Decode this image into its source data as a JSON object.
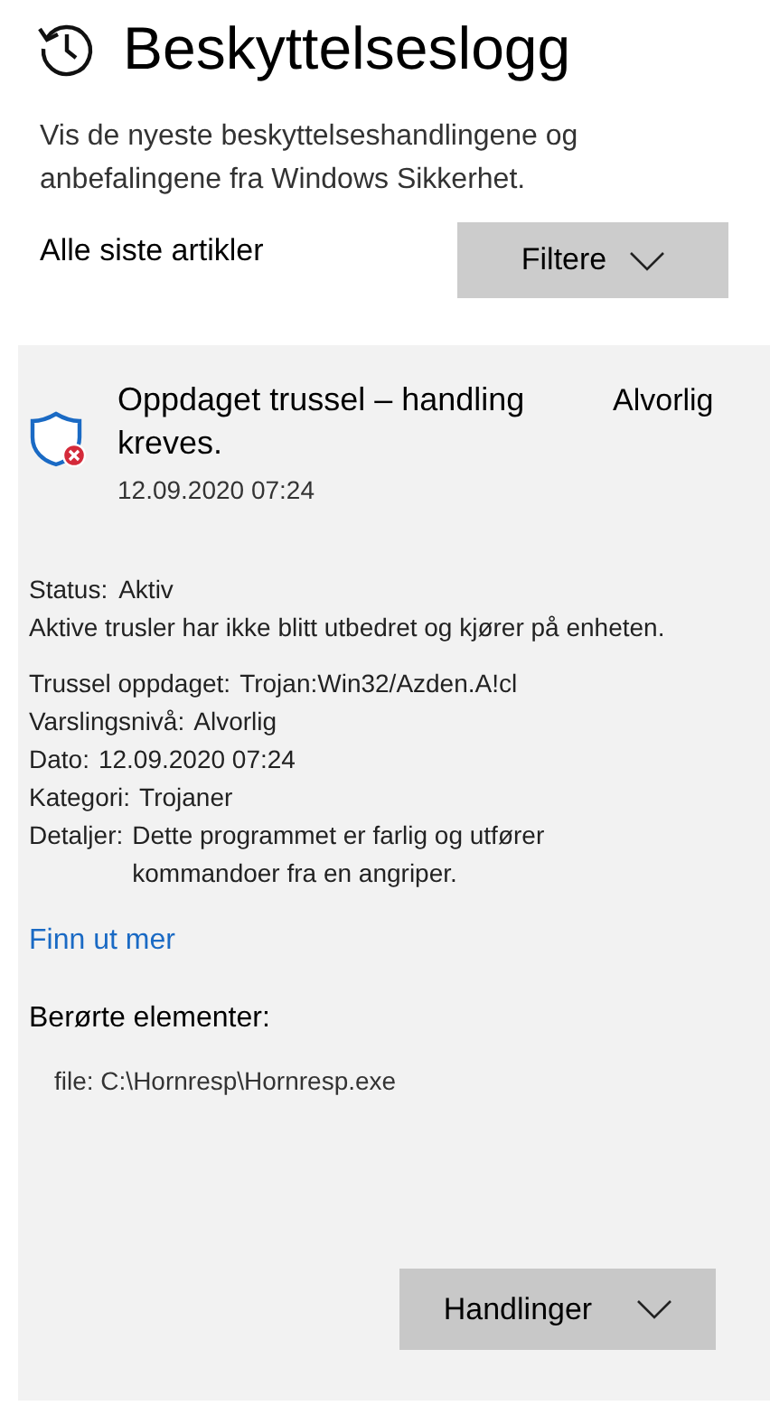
{
  "page": {
    "title": "Beskyttelseslogg",
    "description": "Vis de nyeste beskyttelseshandlingene og anbefalingene fra Windows Sikkerhet."
  },
  "filter_bar": {
    "label": "Alle siste artikler",
    "button": "Filtere"
  },
  "item": {
    "title": "Oppdaget trussel – handling kreves.",
    "date": "12.09.2020 07:24",
    "severity": "Alvorlig",
    "status": {
      "label": "Status:",
      "value": "Aktiv"
    },
    "status_note": "Aktive trusler har ikke blitt utbedret og kjører på enheten.",
    "fields": [
      {
        "label": "Trussel oppdaget:",
        "value": "Trojan:Win32/Azden.A!cl"
      },
      {
        "label": "Varslingsnivå:",
        "value": "Alvorlig"
      },
      {
        "label": "Dato:",
        "value": "12.09.2020 07:24"
      },
      {
        "label": "Kategori:",
        "value": "Trojaner"
      },
      {
        "label": "Detaljer:",
        "value": "Dette programmet er farlig og utfører kommandoer fra en angriper."
      }
    ],
    "link": "Finn ut mer",
    "affected_heading": "Berørte elementer:",
    "affected": [
      "file: C:\\Hornresp\\Hornresp.exe"
    ],
    "actions_button": "Handlinger"
  }
}
